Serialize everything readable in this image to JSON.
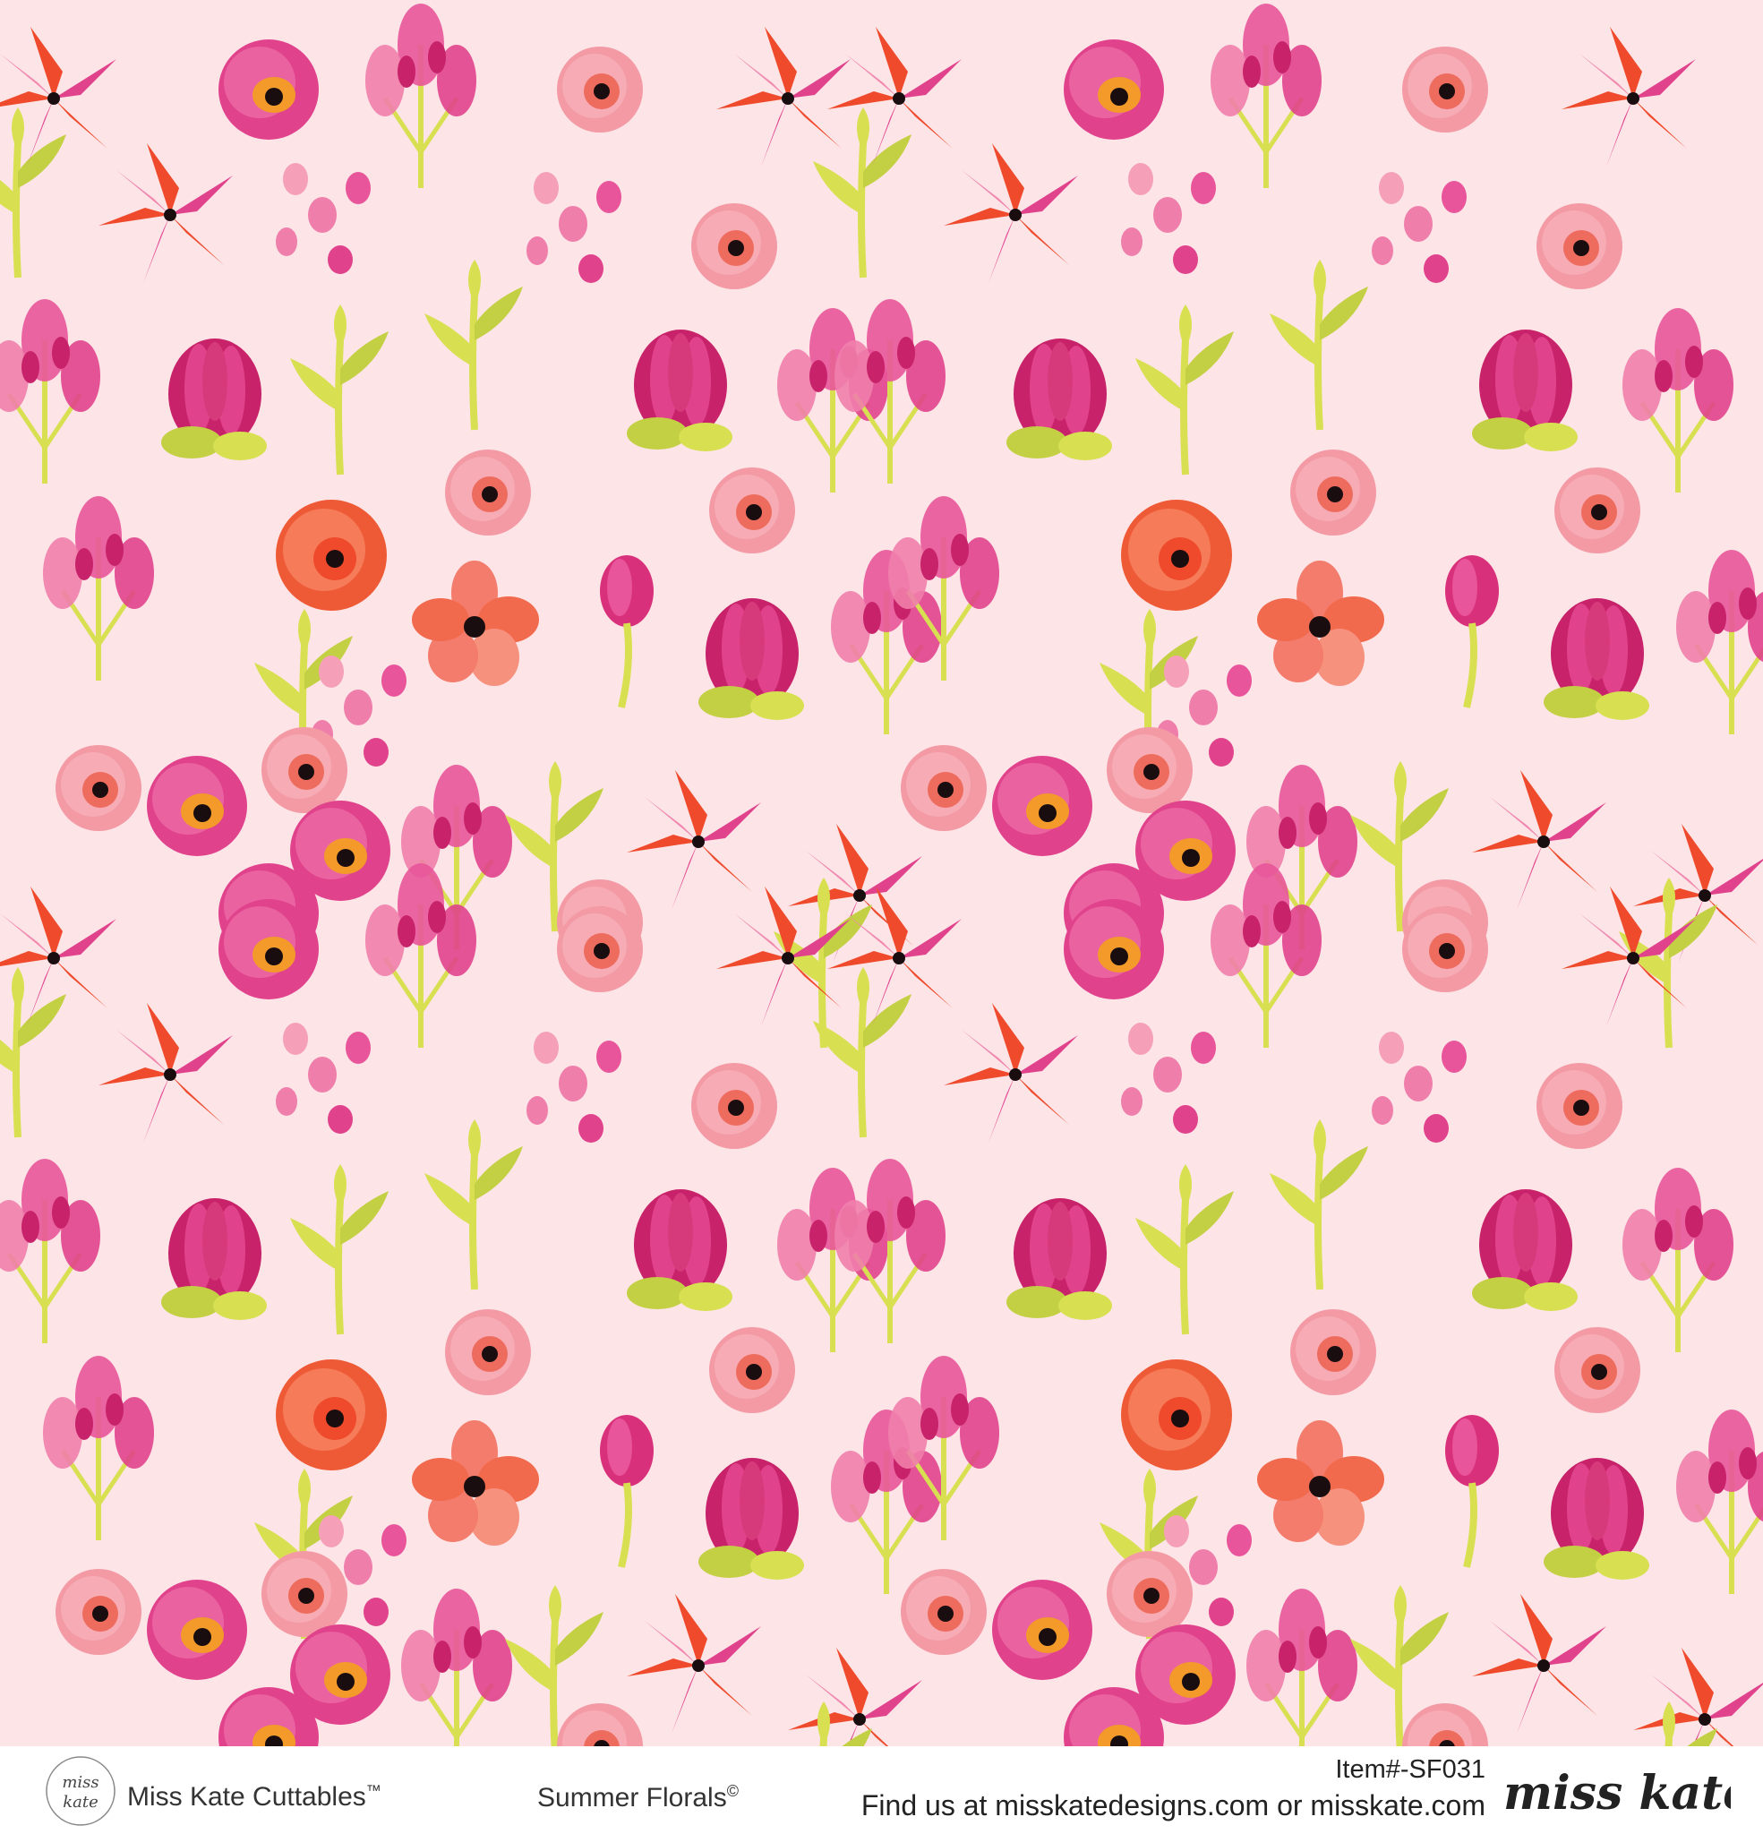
{
  "footer": {
    "brand": "Miss Kate Cuttables",
    "brand_mark": "™",
    "product": "Summer Florals",
    "product_mark": "©",
    "item_number": "Item#-SF031",
    "find_us": "Find us at misskatedesigns.com or misskate.com",
    "logo_text": "miss kate",
    "signature_text": "miss kate"
  },
  "pattern": {
    "background_color": "#fde4e7",
    "motifs": [
      "poppy-flower",
      "rose-bud",
      "red-star-flower",
      "magenta-protea",
      "pink-heather-spray",
      "orange-rose",
      "coral-blossom",
      "lime-leaf-sprig"
    ],
    "colors": {
      "magenta": "#e0438c",
      "deep_magenta": "#c8226a",
      "pink": "#ef7eab",
      "light_pink": "#f5a0b8",
      "coral": "#f47c6c",
      "orange_red": "#ee4a2b",
      "orange": "#f39a2a",
      "lime": "#d8e052",
      "olive_lime": "#c3d044",
      "center_dark": "#1a0d10"
    }
  }
}
